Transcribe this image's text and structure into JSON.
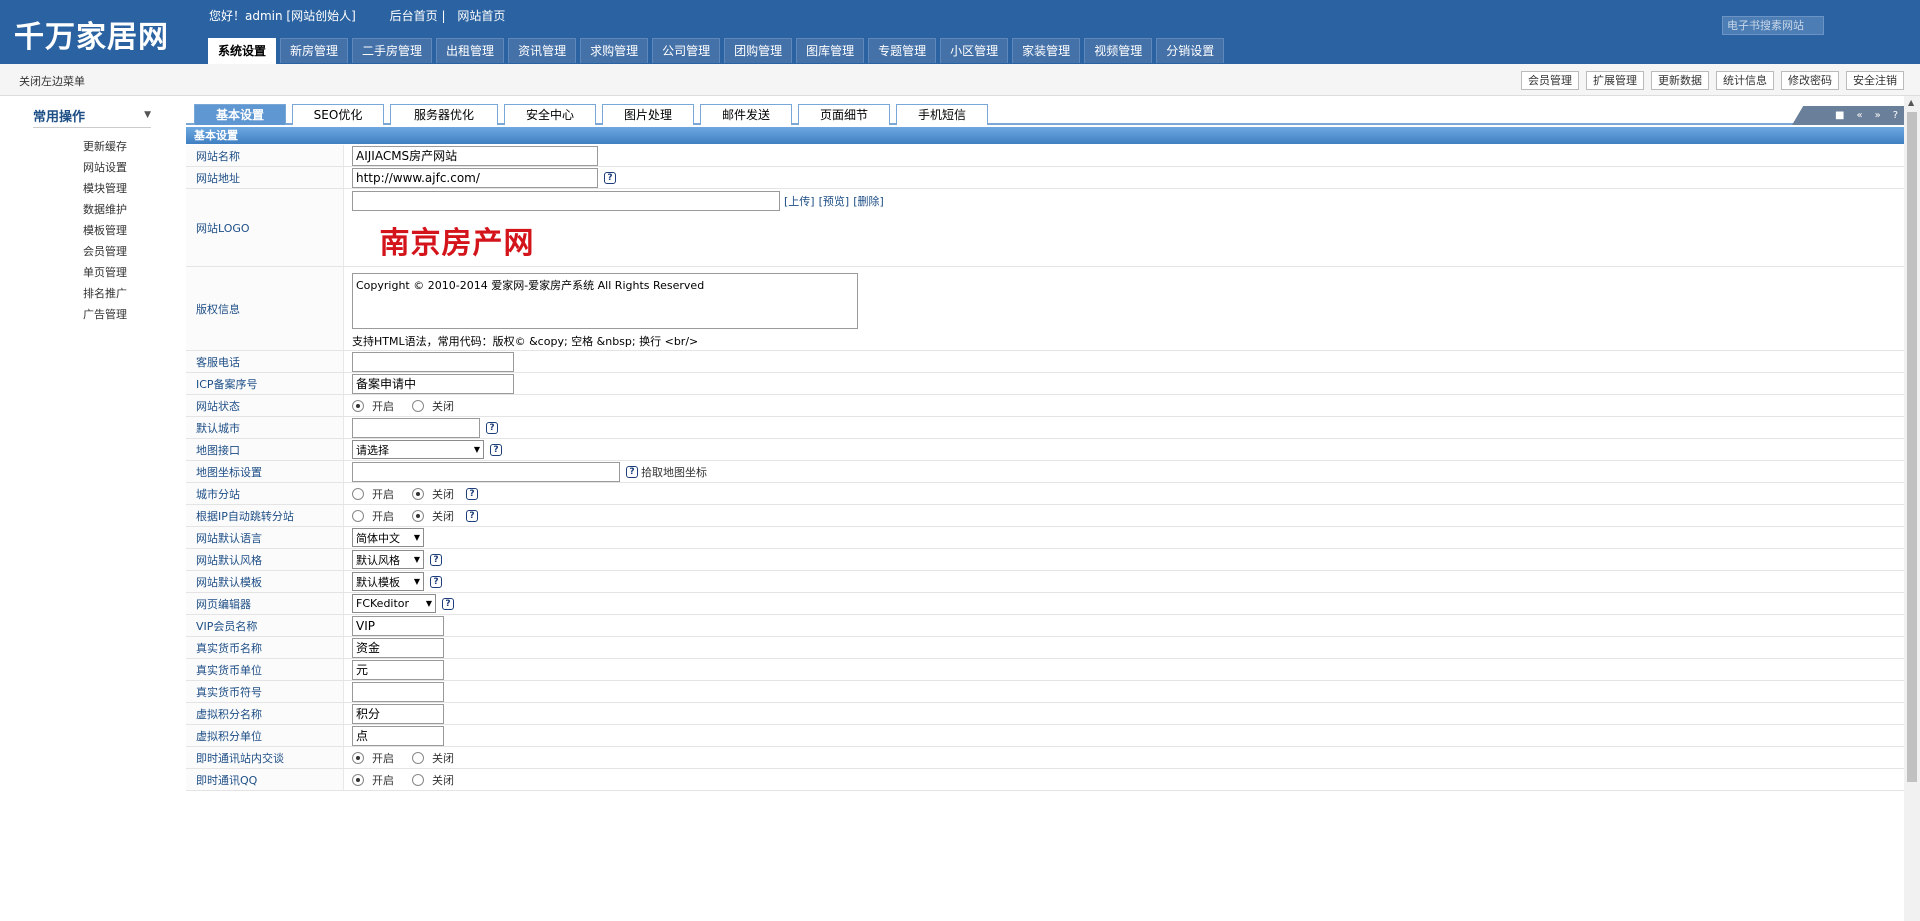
{
  "app": {
    "logo": "千万家居网",
    "welcome": "您好！admin [网站创始人]",
    "backend_home": "后台首页",
    "separator": "|",
    "site_home": "网站首页",
    "search_label": "电子书搜素网站"
  },
  "nav": {
    "tabs": [
      "系统设置",
      "新房管理",
      "二手房管理",
      "出租管理",
      "资讯管理",
      "求购管理",
      "公司管理",
      "团购管理",
      "图库管理",
      "专题管理",
      "小区管理",
      "家装管理",
      "视频管理",
      "分销设置"
    ]
  },
  "subbar": {
    "toggle_menu": "关闭左边菜单",
    "links": [
      "会员管理",
      "扩展管理",
      "更新数据",
      "统计信息",
      "修改密码",
      "安全注销"
    ]
  },
  "sidebar": {
    "title": "常用操作",
    "items": [
      "更新缓存",
      "网站设置",
      "模块管理",
      "数据维护",
      "模板管理",
      "会员管理",
      "单页管理",
      "排名推广",
      "广告管理"
    ]
  },
  "tabs": [
    "基本设置",
    "SEO优化",
    "服务器优化",
    "安全中心",
    "图片处理",
    "邮件发送",
    "页面细节",
    "手机短信"
  ],
  "tools": [
    "■",
    "«",
    "»",
    "?"
  ],
  "section_title": "基本设置",
  "form": {
    "site_name": {
      "label": "网站名称",
      "value": "AIJIACMS房产网站"
    },
    "site_url": {
      "label": "网站地址",
      "value": "http://www.ajfc.com/"
    },
    "site_logo": {
      "label": "网站LOGO",
      "value": "",
      "upload": "[上传]",
      "preview": "[预览]",
      "delete": "[删除]",
      "logo_text": "南京房产网"
    },
    "copyright": {
      "label": "版权信息",
      "value": "Copyright © 2010-2014 爱家网-爱家房产系统 All Rights Reserved",
      "hint": "支持HTML语法，常用代码：版权© &copy; 空格 &nbsp; 换行 <br/>"
    },
    "service_phone": {
      "label": "客服电话",
      "value": ""
    },
    "icp": {
      "label": "ICP备案序号",
      "value": "备案申请中"
    },
    "site_status": {
      "label": "网站状态",
      "on": "开启",
      "off": "关闭"
    },
    "default_city": {
      "label": "默认城市",
      "value": ""
    },
    "map_api": {
      "label": "地图接口",
      "value": "请选择"
    },
    "map_coords": {
      "label": "地图坐标设置",
      "value": "",
      "pick": "拾取地图坐标"
    },
    "city_site": {
      "label": "城市分站",
      "on": "开启",
      "off": "关闭"
    },
    "ip_redirect": {
      "label": "根据IP自动跳转分站",
      "on": "开启",
      "off": "关闭"
    },
    "default_lang": {
      "label": "网站默认语言",
      "value": "简体中文"
    },
    "default_style": {
      "label": "网站默认风格",
      "value": "默认风格"
    },
    "default_template": {
      "label": "网站默认模板",
      "value": "默认模板"
    },
    "editor": {
      "label": "网页编辑器",
      "value": "FCKeditor"
    },
    "vip_name": {
      "label": "VIP会员名称",
      "value": "VIP"
    },
    "money_name": {
      "label": "真实货币名称",
      "value": "资金"
    },
    "money_unit": {
      "label": "真实货币单位",
      "value": "元"
    },
    "money_symbol": {
      "label": "真实货币符号",
      "value": ""
    },
    "credit_name": {
      "label": "虚拟积分名称",
      "value": "积分"
    },
    "credit_unit": {
      "label": "虚拟积分单位",
      "value": "点"
    },
    "im_chat": {
      "label": "即时通讯站内交谈",
      "on": "开启",
      "off": "关闭"
    },
    "im_qq": {
      "label": "即时通讯QQ",
      "on": "开启",
      "off": "关闭"
    }
  },
  "help_icon": "?"
}
